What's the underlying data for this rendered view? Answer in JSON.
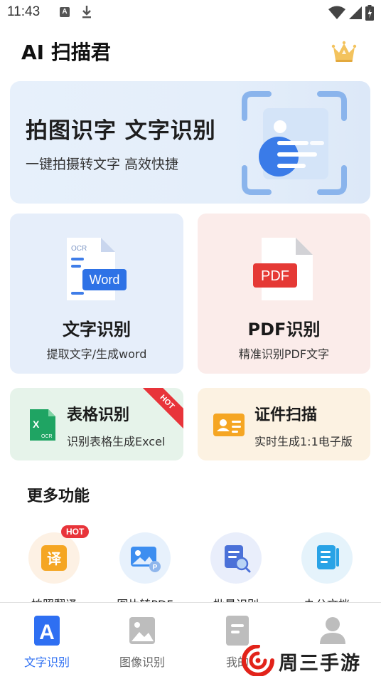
{
  "status_bar": {
    "time": "11:43",
    "notif_letter": "A"
  },
  "header": {
    "title": "AI 扫描君"
  },
  "banner": {
    "title": "拍图识字  文字识别",
    "subtitle": "一键拍摄转文字  高效快捷"
  },
  "cards": {
    "word": {
      "title": "文字识别",
      "subtitle": "提取文字/生成word",
      "icon_tag": "OCR",
      "icon_label": "Word"
    },
    "pdf": {
      "title": "PDF识别",
      "subtitle": "精准识别PDF文字",
      "icon_label": "PDF"
    },
    "table": {
      "title": "表格识别",
      "subtitle": "识别表格生成Excel",
      "badge": "HOT",
      "icon_letter": "X",
      "icon_tag": "OCR"
    },
    "id": {
      "title": "证件扫描",
      "subtitle": "实时生成1:1电子版"
    }
  },
  "more": {
    "title": "更多功能",
    "items": [
      {
        "label": "拍照翻译",
        "badge": "HOT",
        "glyph": "译",
        "icon": "translate-icon"
      },
      {
        "label": "图片转PDF",
        "badge": "",
        "icon": "image-to-pdf-icon",
        "sub_glyph": "P"
      },
      {
        "label": "批量识别",
        "badge": "",
        "icon": "batch-scan-icon"
      },
      {
        "label": "办公文档",
        "badge": "",
        "icon": "office-document-icon"
      }
    ]
  },
  "nav": {
    "items": [
      {
        "label": "文字识别",
        "active": true,
        "icon": "text-recognition-icon",
        "glyph": "A"
      },
      {
        "label": "图像识别",
        "active": false,
        "icon": "image-recognition-icon"
      },
      {
        "label": "我的",
        "active": false,
        "icon": "document-icon"
      },
      {
        "label": "",
        "active": false,
        "icon": "user-icon"
      }
    ]
  },
  "watermark": {
    "text": "周三手游网"
  },
  "colors": {
    "accent": "#2e6ff2",
    "hot": "#e8343a",
    "pdf_red": "#e53935",
    "excel_green": "#1fa463",
    "id_orange": "#f5a623",
    "translate_orange": "#f5a623"
  }
}
